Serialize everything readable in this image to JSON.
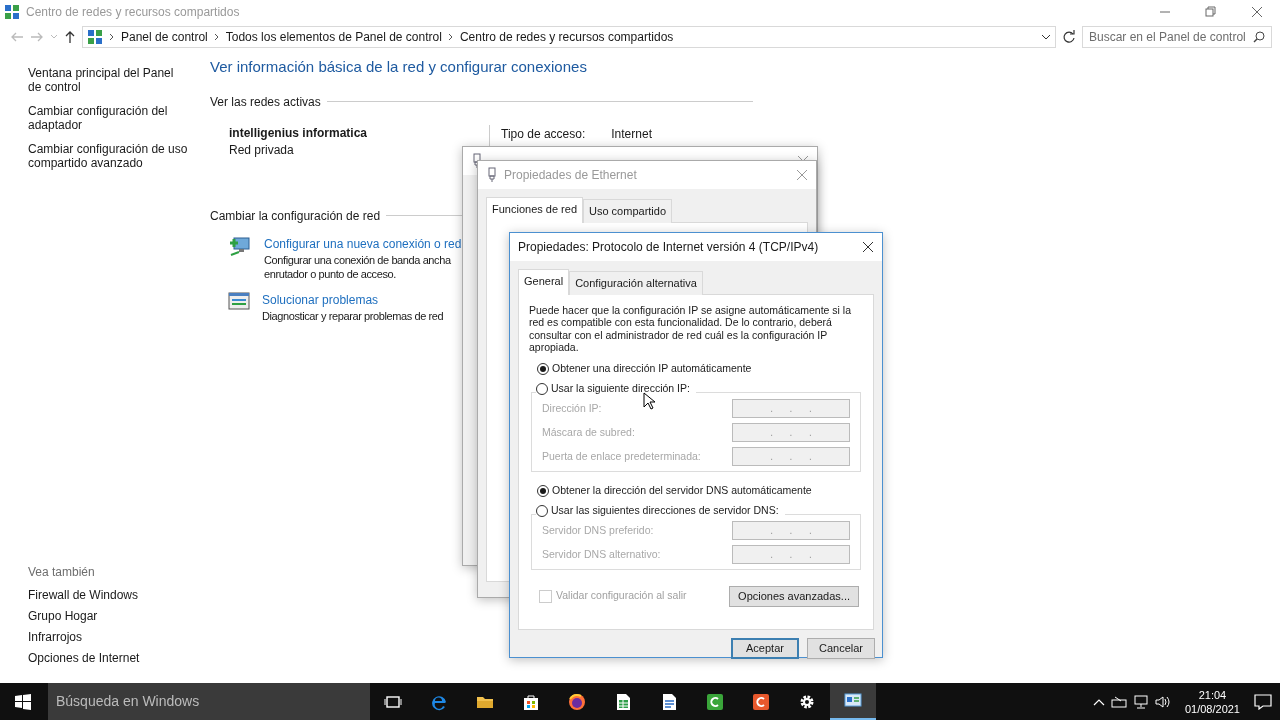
{
  "window": {
    "title": "Centro de redes y recursos compartidos"
  },
  "address_bar": {
    "breadcrumbs": [
      "Panel de control",
      "Todos los elementos de Panel de control",
      "Centro de redes y recursos compartidos"
    ]
  },
  "search": {
    "placeholder": "Buscar en el Panel de control"
  },
  "sidebar": {
    "links": [
      "Ventana principal del Panel de control",
      "Cambiar configuración del adaptador",
      "Cambiar configuración de uso compartido avanzado"
    ],
    "see_also_title": "Vea también",
    "see_also": [
      "Firewall de Windows",
      "Grupo Hogar",
      "Infrarrojos",
      "Opciones de Internet"
    ]
  },
  "main": {
    "heading": "Ver información básica de la red y configurar conexiones",
    "active_networks_label": "Ver las redes activas",
    "network": {
      "name": "intelligenius informatica",
      "type": "Red privada"
    },
    "access_type_label": "Tipo de acceso:",
    "access_type": "Internet",
    "change_label": "Cambiar la configuración de red",
    "tasks": [
      {
        "kind": "new-connection",
        "title": "Configurar una nueva conexión o red",
        "description": "Configurar una conexión de banda ancha",
        "description_2": "enrutador o punto de acceso."
      },
      {
        "kind": "troubleshoot",
        "title": "Solucionar problemas",
        "description": "Diagnosticar y reparar problemas de red"
      }
    ]
  },
  "ethernet_properties": {
    "title": "Propiedades de Ethernet",
    "tabs": [
      {
        "label": "Funciones de red",
        "selected": true
      },
      {
        "label": "Uso compartido",
        "selected": false
      }
    ]
  },
  "ipv4_dialog": {
    "title": "Propiedades: Protocolo de Internet versión 4 (TCP/IPv4)",
    "tabs": [
      {
        "label": "General",
        "selected": true
      },
      {
        "label": "Configuración alternativa",
        "selected": false
      }
    ],
    "intro": "Puede hacer que la configuración IP se asigne automáticamente si la red es compatible con esta funcionalidad. De lo contrario, deberá consultar con el administrador de red cuál es la configuración IP apropiada.",
    "groups": [
      {
        "auto": {
          "label": "Obtener una dirección IP automáticamente",
          "selected": true
        },
        "manual": {
          "label": "Usar la siguiente dirección IP:",
          "selected": false
        },
        "fields": [
          {
            "label": "Dirección IP:",
            "value": ".      .      .",
            "disabled": true
          },
          {
            "label": "Máscara de subred:",
            "value": ".      .      .",
            "disabled": true
          },
          {
            "label": "Puerta de enlace predeterminada:",
            "value": ".      .      .",
            "disabled": true
          }
        ]
      },
      {
        "auto": {
          "label": "Obtener la dirección del servidor DNS automáticamente",
          "selected": true
        },
        "manual": {
          "label": "Usar las siguientes direcciones de servidor DNS:",
          "selected": false
        },
        "fields": [
          {
            "label": "Servidor DNS preferido:",
            "value": ".      .      .",
            "disabled": true
          },
          {
            "label": "Servidor DNS alternativo:",
            "value": ".      .      .",
            "disabled": true
          }
        ]
      }
    ],
    "validate": {
      "label": "Validar configuración al salir",
      "checked": false,
      "disabled": true
    },
    "advanced_button": "Opciones avanzadas...",
    "buttons": [
      {
        "label": "Aceptar",
        "default": true
      },
      {
        "label": "Cancelar",
        "default": false
      }
    ]
  },
  "taskbar": {
    "search_placeholder": "Búsqueda en Windows",
    "apps": [
      {
        "kind": "task-view",
        "selected": false
      },
      {
        "kind": "browser-e",
        "selected": false
      },
      {
        "kind": "folder",
        "selected": false
      },
      {
        "kind": "store",
        "selected": false
      },
      {
        "kind": "globe",
        "selected": false
      },
      {
        "kind": "spreadsheet",
        "selected": false
      },
      {
        "kind": "document",
        "selected": false
      },
      {
        "kind": "app-green",
        "selected": false
      },
      {
        "kind": "app-orange",
        "selected": false
      },
      {
        "kind": "settings",
        "selected": false
      },
      {
        "kind": "control-panel",
        "selected": true
      }
    ],
    "time": "21:04",
    "date": "01/08/2021"
  }
}
